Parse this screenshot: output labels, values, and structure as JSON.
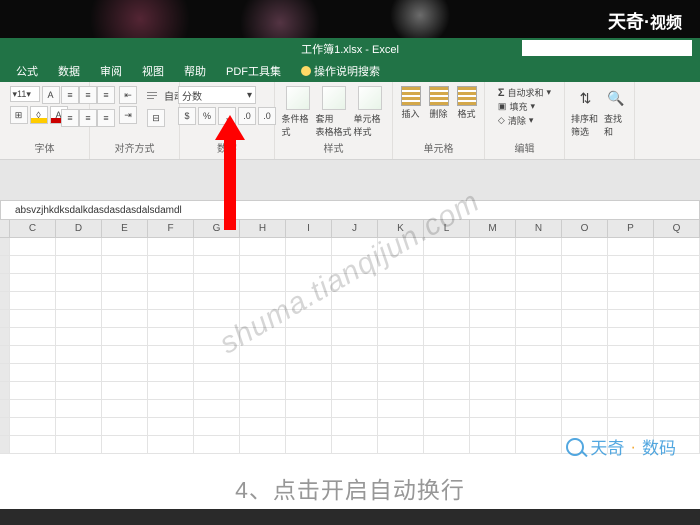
{
  "brand_top_a": "天奇",
  "brand_top_b": "视频",
  "title": "工作簿1.xlsx - Excel",
  "menu": {
    "m0": "公式",
    "m1": "数据",
    "m2": "审阅",
    "m3": "视图",
    "m4": "帮助",
    "m5": "PDF工具集",
    "m6": "操作说明搜索"
  },
  "ribbon": {
    "font_size": "11",
    "wrap_text": "自动换行",
    "merge": "合并后居中",
    "number_format": "分数",
    "cond_format": "条件格式",
    "table_format": "套用\n表格格式",
    "cell_style": "单元格样式",
    "insert": "插入",
    "delete": "删除",
    "format": "格式",
    "autosum": "自动求和",
    "fill": "填充",
    "clear": "清除",
    "sort": "排序和筛选",
    "find": "查找和",
    "g_font": "字体",
    "g_align": "对齐方式",
    "g_number": "数字",
    "g_style": "样式",
    "g_cell": "单元格",
    "g_edit": "编辑"
  },
  "formula": "absvzjhkdksdalkdasdasdasdalsdamdl",
  "cols": {
    "c1": "C",
    "c2": "D",
    "c3": "E",
    "c4": "F",
    "c5": "G",
    "c6": "H",
    "c7": "I",
    "c8": "J",
    "c9": "K",
    "c10": "L",
    "c11": "M",
    "c12": "N",
    "c13": "O",
    "c14": "P",
    "c15": "Q"
  },
  "watermark": "shuma.tianqijun.com",
  "brand_bottom_a": "天奇",
  "brand_bottom_b": "数码",
  "subtitle": "4、点击开启自动换行"
}
